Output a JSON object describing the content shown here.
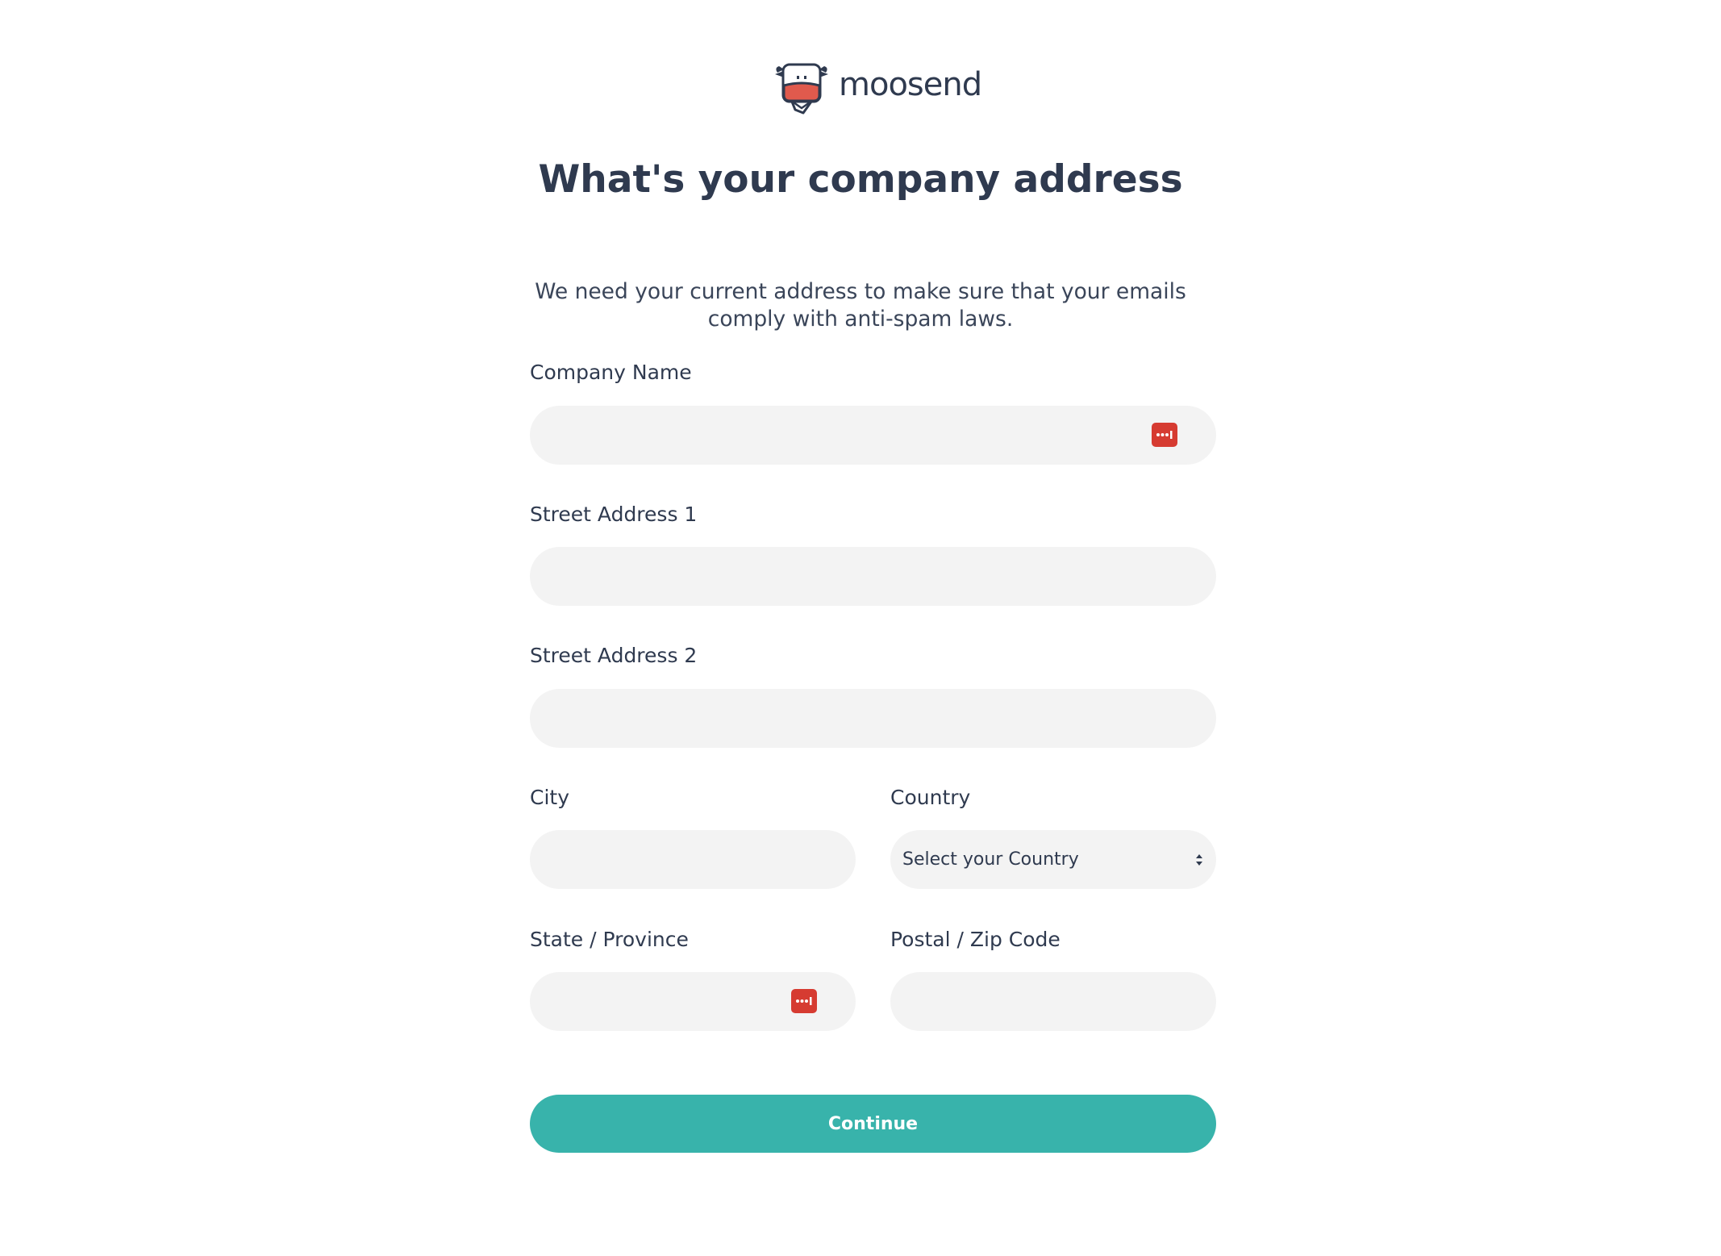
{
  "brand": {
    "logo_text": "moosend",
    "logo_icon": "cow-mascot-icon"
  },
  "header": {
    "title": "What's your company address",
    "subtitle": "We need your current address to make sure that your emails comply with anti-spam laws."
  },
  "form": {
    "company_name": {
      "label": "Company Name",
      "value": "",
      "placeholder": ""
    },
    "street_address_1": {
      "label": "Street Address 1",
      "value": "",
      "placeholder": ""
    },
    "street_address_2": {
      "label": "Street Address 2",
      "value": "",
      "placeholder": ""
    },
    "city": {
      "label": "City",
      "value": "",
      "placeholder": ""
    },
    "country": {
      "label": "Country",
      "selected": "Select your Country"
    },
    "state_province": {
      "label": "State / Province",
      "value": "",
      "placeholder": ""
    },
    "postal_zip": {
      "label": "Postal / Zip Code",
      "value": "",
      "placeholder": ""
    },
    "password_manager_icon": "password-manager-icon"
  },
  "actions": {
    "continue_label": "Continue"
  },
  "colors": {
    "accent": "#38b3ab",
    "text": "#2f3a4f",
    "field_bg": "#f3f3f3",
    "icon_red": "#d63b31"
  }
}
